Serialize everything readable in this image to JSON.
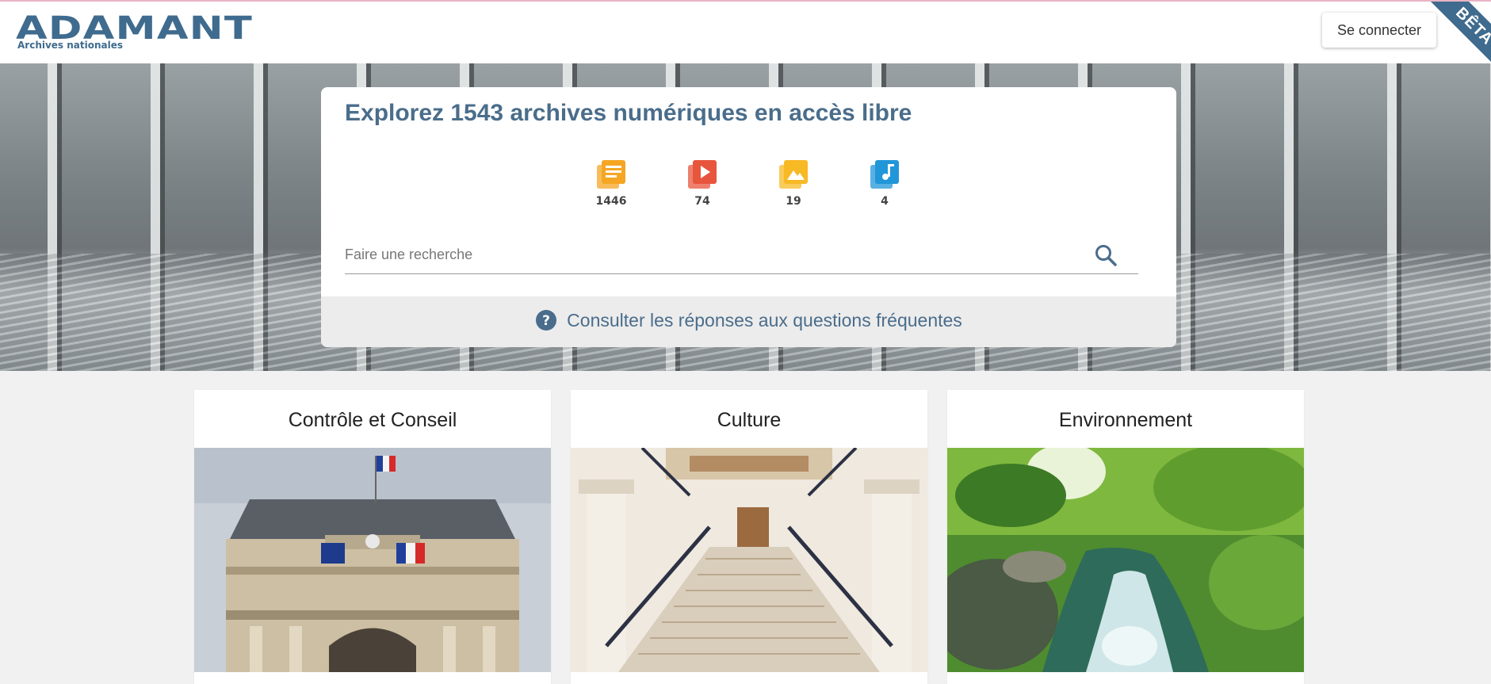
{
  "header": {
    "logo_text": "ADAMANT",
    "logo_subtitle": "Archives nationales",
    "login_label": "Se connecter",
    "beta_label": "BÊTA"
  },
  "search_card": {
    "title": "Explorez 1543 archives numériques en accès libre",
    "stats": [
      {
        "icon": "document-library-icon",
        "count": "1446",
        "color": "#f5a623"
      },
      {
        "icon": "video-library-icon",
        "count": "74",
        "color": "#e8553d"
      },
      {
        "icon": "image-library-icon",
        "count": "19",
        "color": "#f7b924"
      },
      {
        "icon": "audio-library-icon",
        "count": "4",
        "color": "#2196d8"
      }
    ],
    "search": {
      "placeholder": "Faire une recherche",
      "value": ""
    },
    "faq_label": "Consulter les réponses aux questions fréquentes"
  },
  "categories": [
    {
      "title": "Contrôle et Conseil"
    },
    {
      "title": "Culture"
    },
    {
      "title": "Environnement"
    }
  ]
}
